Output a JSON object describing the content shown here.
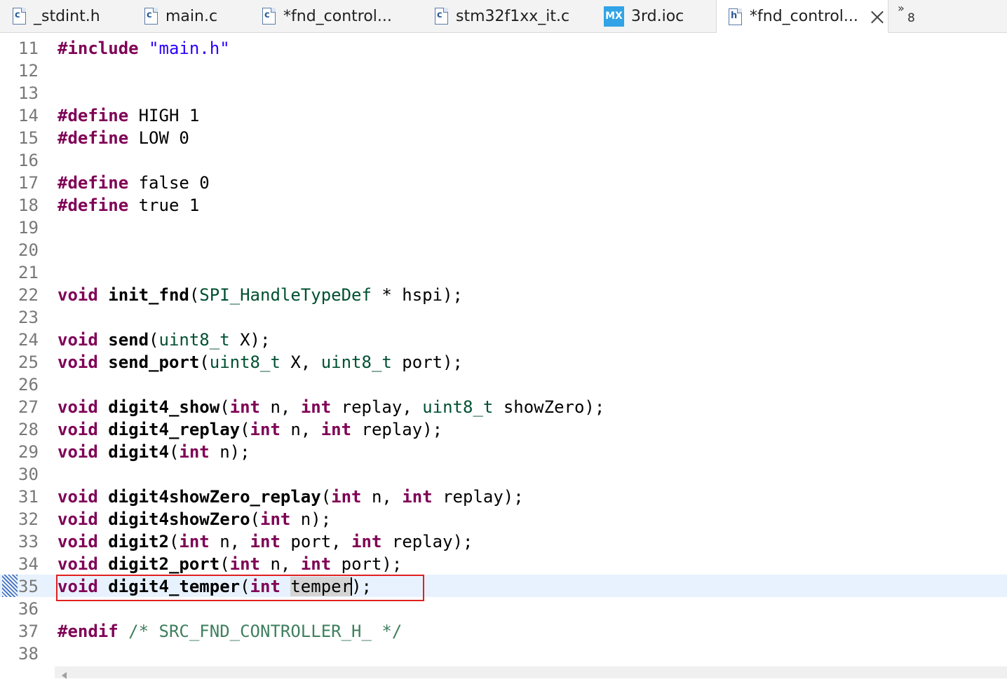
{
  "tabs": [
    {
      "label": "_stdint.h",
      "icon": "c-file-icon",
      "glyph": "c"
    },
    {
      "label": "main.c",
      "icon": "c-file-icon",
      "glyph": "c"
    },
    {
      "label": "*fnd_control...",
      "icon": "c-file-icon",
      "glyph": "c"
    },
    {
      "label": "stm32f1xx_it.c",
      "icon": "c-file-icon",
      "glyph": "c"
    },
    {
      "label": "3rd.ioc",
      "icon": "mx-file-icon",
      "glyph": "MX"
    },
    {
      "label": "*fnd_control...",
      "icon": "h-file-icon",
      "glyph": "h",
      "active": true
    }
  ],
  "overflow": {
    "chevron": "»",
    "count": "8"
  },
  "editor": {
    "current_line": 35,
    "lines": [
      {
        "n": "11",
        "code": "#include \"main.h\""
      },
      {
        "n": "12",
        "code": ""
      },
      {
        "n": "13",
        "code": ""
      },
      {
        "n": "14",
        "code": "#define HIGH 1"
      },
      {
        "n": "15",
        "code": "#define LOW 0"
      },
      {
        "n": "16",
        "code": ""
      },
      {
        "n": "17",
        "code": "#define false 0"
      },
      {
        "n": "18",
        "code": "#define true 1"
      },
      {
        "n": "19",
        "code": ""
      },
      {
        "n": "20",
        "code": ""
      },
      {
        "n": "21",
        "code": ""
      },
      {
        "n": "22",
        "code": "void init_fnd(SPI_HandleTypeDef * hspi);"
      },
      {
        "n": "23",
        "code": ""
      },
      {
        "n": "24",
        "code": "void send(uint8_t X);"
      },
      {
        "n": "25",
        "code": "void send_port(uint8_t X, uint8_t port);"
      },
      {
        "n": "26",
        "code": ""
      },
      {
        "n": "27",
        "code": "void digit4_show(int n, int replay, uint8_t showZero);"
      },
      {
        "n": "28",
        "code": "void digit4_replay(int n, int replay);"
      },
      {
        "n": "29",
        "code": "void digit4(int n);"
      },
      {
        "n": "30",
        "code": ""
      },
      {
        "n": "31",
        "code": "void digit4showZero_replay(int n, int replay);"
      },
      {
        "n": "32",
        "code": "void digit4showZero(int n);"
      },
      {
        "n": "33",
        "code": "void digit2(int n, int port, int replay);"
      },
      {
        "n": "34",
        "code": "void digit2_port(int n, int port);"
      },
      {
        "n": "35",
        "code": "void digit4_temper(int temper);"
      },
      {
        "n": "36",
        "code": ""
      },
      {
        "n": "37",
        "code": "#endif /* SRC_FND_CONTROLLER_H_ */"
      },
      {
        "n": "38",
        "code": ""
      }
    ]
  },
  "colors": {
    "keyword": "#7f0055",
    "type": "#005032",
    "string": "#2a00ff",
    "comment": "#3f7f5f",
    "line_number": "#787878",
    "current_line_bg": "#e8f2fe",
    "highlight_box": "#e0201e"
  }
}
